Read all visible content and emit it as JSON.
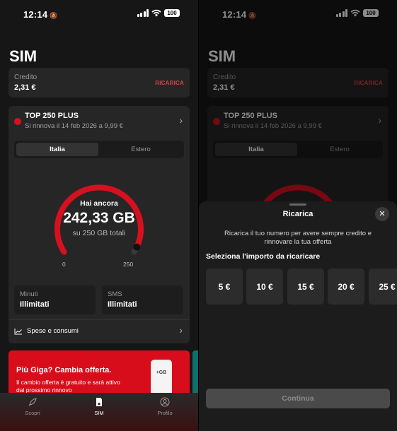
{
  "status": {
    "time": "12:14",
    "battery": "100"
  },
  "page": {
    "title": "SIM"
  },
  "credit": {
    "label": "Credito",
    "value": "2,31 €",
    "action": "RICARICA"
  },
  "plan": {
    "name": "TOP 250 PLUS",
    "renewal": "Si rinnova il 14 feb 2026 a 9,99 €"
  },
  "segment": {
    "tabs": [
      "Italia",
      "Estero"
    ],
    "selected": "Italia"
  },
  "usage": {
    "heading": "Hai ancora",
    "remaining": "242,33 GB",
    "total": "su 250 GB totali",
    "min_label": "0",
    "max_label": "250",
    "remaining_fraction": 0.969,
    "accent": "#d7101f"
  },
  "allowances": [
    {
      "label": "Minuti",
      "value": "Illimitati"
    },
    {
      "label": "SMS",
      "value": "Illimitati"
    }
  ],
  "spese": {
    "label": "Spese e consumi",
    "icon": "chart-line-icon"
  },
  "promo": {
    "title": "Più Giga? Cambia offerta.",
    "body": "Il cambio offerta è gratuito e sarà attivo dal prossimo rinnovo",
    "badge": "+GB",
    "color": "#d80d1c"
  },
  "tabbar": [
    {
      "label": "Scopri",
      "icon": "rocket-icon"
    },
    {
      "label": "SIM",
      "icon": "sim-icon"
    },
    {
      "label": "Profilo",
      "icon": "profile-icon"
    }
  ],
  "sheet": {
    "title": "Ricarica",
    "description": "Ricarica il tuo numero per avere sempre credito e rinnovare la tua offerta",
    "select_label": "Seleziona l'importo da ricaricare",
    "amounts": [
      "5 €",
      "10 €",
      "15 €",
      "20 €",
      "25 €"
    ],
    "continue_label": "Continua"
  }
}
